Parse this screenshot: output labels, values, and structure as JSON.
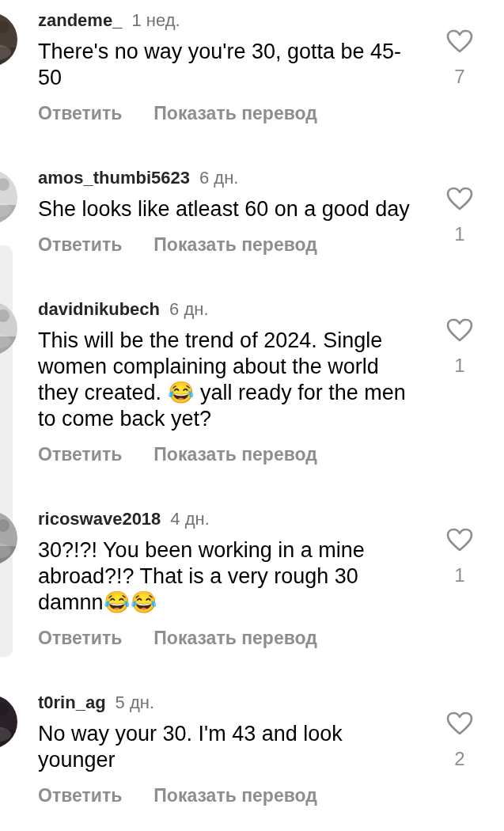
{
  "comments": [
    {
      "username": "zandeme_",
      "time": "1 нед.",
      "text": "There's no way you're 30, gotta be 45-50",
      "likes": "7",
      "actions": [
        "Ответить",
        "Показать перевод"
      ]
    },
    {
      "username": "amos_thumbi5623",
      "time": "6 дн.",
      "text": "She looks like  atleast  60 on a  good day",
      "likes": "1",
      "actions": [
        "Ответить",
        "Показать перевод"
      ]
    },
    {
      "username": "davidnikubech",
      "time": "6 дн.",
      "text": "This will be the trend of 2024. Single women complaining about the world they created. 😂 yall ready for the men to come back yet?",
      "likes": "1",
      "actions": [
        "Ответить",
        "Показать перевод"
      ]
    },
    {
      "username": "ricoswave2018",
      "time": "4 дн.",
      "text": "30?!?! You been working in a mine abroad?!? That is a very rough 30 damnn😂😂",
      "likes": "1",
      "actions": [
        "Ответить",
        "Показать перевод"
      ]
    },
    {
      "username": "t0rin_ag",
      "time": "5 дн.",
      "text": "No way your 30. I'm 43 and look younger",
      "likes": "2",
      "actions": [
        "Ответить",
        "Показать перевод"
      ]
    }
  ]
}
